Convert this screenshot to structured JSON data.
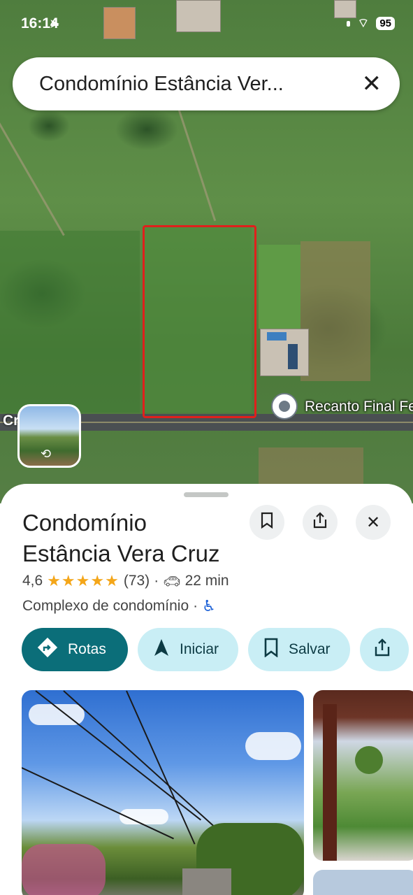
{
  "status_bar": {
    "time": "16:14",
    "battery": "95"
  },
  "search": {
    "query": "Condomínio Estância Ver..."
  },
  "map": {
    "pin_label": "Recanto Final Fe",
    "edge_label": "Cr",
    "street_view_icon": "rotate-360-icon"
  },
  "place": {
    "name_line1": "Condomínio",
    "name_line2": "Estância Vera Cruz",
    "rating": "4,6",
    "stars": "★★★★★",
    "review_count": "(73)",
    "separator": "·",
    "drive_time": "22 min",
    "category": "Complexo de condomínio",
    "category_separator": "·"
  },
  "actions": {
    "directions": "Rotas",
    "start": "Iniciar",
    "save": "Salvar"
  },
  "colors": {
    "primary": "#0b6e79",
    "secondary_chip": "#c9eef5",
    "annotation": "#e0201c"
  }
}
